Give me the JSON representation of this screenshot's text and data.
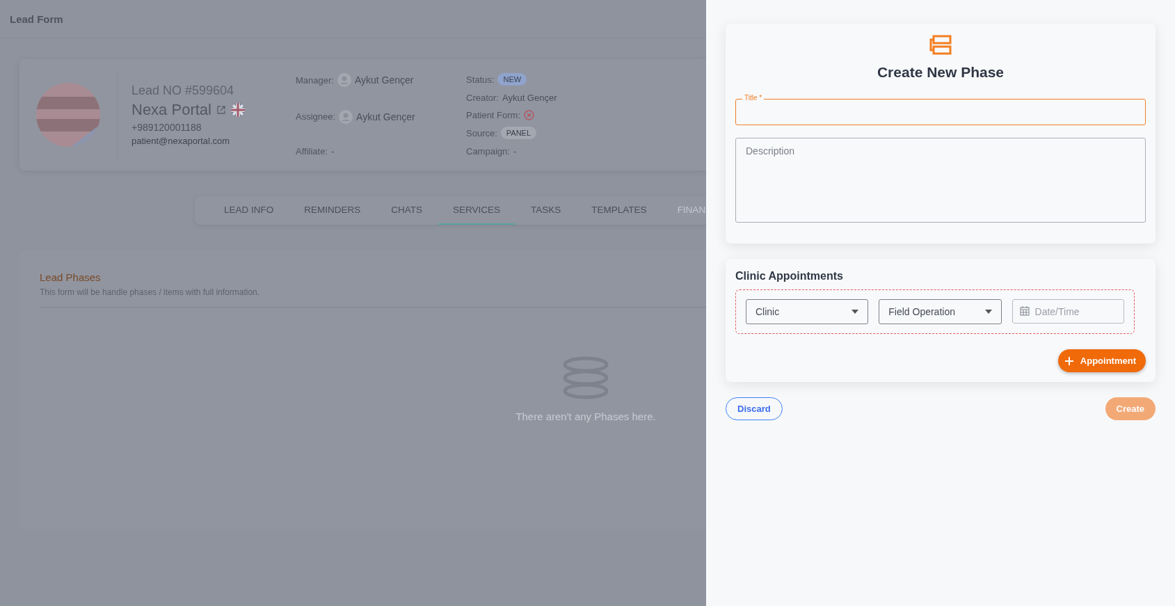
{
  "modal": {
    "title": "Lead Form"
  },
  "lead": {
    "number": "Lead NO #599604",
    "name": "Nexa Portal",
    "phone": "+989120001188",
    "email": "patient@nexaportal.com",
    "people": [
      {
        "label": "Manager:",
        "value": "Aykut Gençer",
        "kind": "person"
      },
      {
        "label": "Assignee:",
        "value": "Aykut Gençer",
        "kind": "person"
      },
      {
        "label": "Affiliate:",
        "value": "-",
        "kind": "text"
      }
    ],
    "facts": [
      {
        "label": "Status:",
        "value": "NEW",
        "kind": "badge",
        "color": "#8fa3cc"
      },
      {
        "label": "Creator:",
        "value": "Aykut Gençer",
        "kind": "text"
      },
      {
        "label": "Patient Form:",
        "kind": "missing"
      },
      {
        "label": "Source:",
        "value": "PANEL",
        "kind": "badge",
        "color": "#a3a7b0"
      },
      {
        "label": "Campaign:",
        "value": "-",
        "kind": "text"
      }
    ]
  },
  "tabs": [
    {
      "label": "LEAD INFO",
      "selected": false
    },
    {
      "label": "REMINDERS",
      "selected": false
    },
    {
      "label": "CHATS",
      "selected": false
    },
    {
      "label": "SERVICES",
      "selected": true
    },
    {
      "label": "TASKS",
      "selected": false
    },
    {
      "label": "TEMPLATES",
      "selected": false
    },
    {
      "label": "FINAN",
      "selected": false
    }
  ],
  "phases": {
    "title": "Lead Phases",
    "subtitle": "This form will be handle phases / items with full information.",
    "empty": "There aren't any Phases here."
  },
  "create_phase": {
    "title": "Create New Phase",
    "title_field": {
      "label": "Title *",
      "focused": true
    },
    "description": {
      "placeholder": "Description"
    }
  },
  "appointments": {
    "title": "Clinic Appointments",
    "clinic": {
      "value": "Clinic"
    },
    "operation": {
      "value": "Field Operation"
    },
    "date": {
      "placeholder": "Date/Time"
    },
    "add_button": "Appointment"
  },
  "actions": [
    {
      "label": "Discard",
      "kind": "outline",
      "disabled": false
    },
    {
      "label": "Create",
      "kind": "primary",
      "disabled": true
    }
  ]
}
